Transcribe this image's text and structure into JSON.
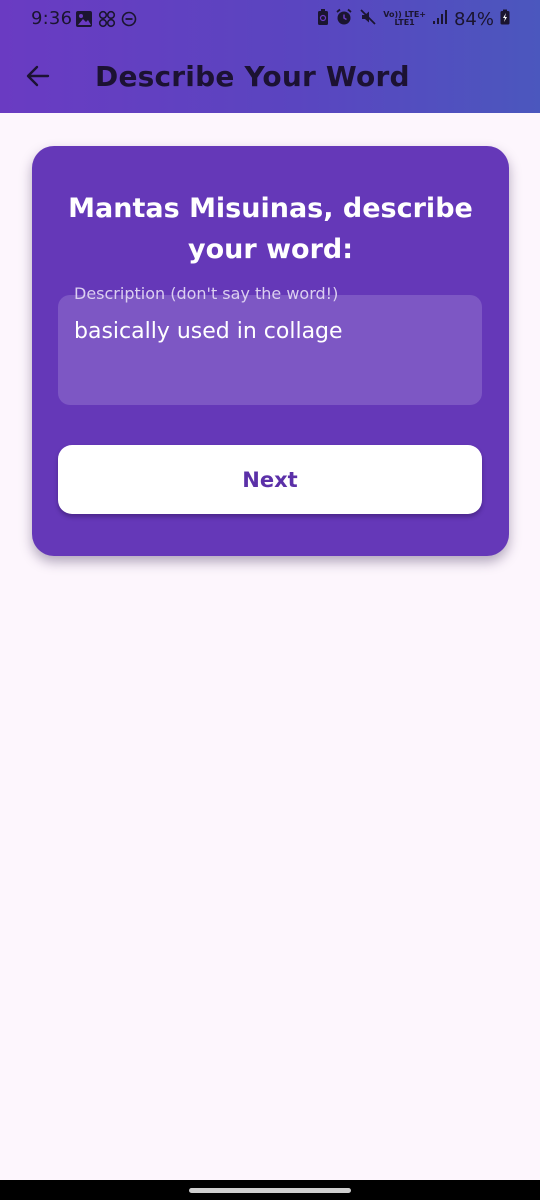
{
  "status_bar": {
    "time": "9:36",
    "network_top": "Vo)) LTE+",
    "network_bottom": "LTE1",
    "battery": "84%",
    "icons": [
      "image-icon",
      "pinwheel-icon",
      "do-not-disturb-icon",
      "battery-saver-icon",
      "alarm-icon",
      "mute-icon",
      "signal-icon",
      "battery-icon"
    ]
  },
  "app_bar": {
    "title": "Describe Your Word",
    "back_icon": "back-arrow-icon"
  },
  "card": {
    "heading": "Mantas Misuinas, describe your word:",
    "description_field": {
      "label": "Description (don't say the word!)",
      "value": "basically used in collage"
    },
    "next_button": "Next"
  },
  "colors": {
    "app_bar_gradient_start": "#6a3bc2",
    "app_bar_gradient_end": "#4b57be",
    "card_background": "#6538b8",
    "field_background": "#7d57c4",
    "button_text": "#5b30a8",
    "page_background": "#fdf6fd"
  }
}
